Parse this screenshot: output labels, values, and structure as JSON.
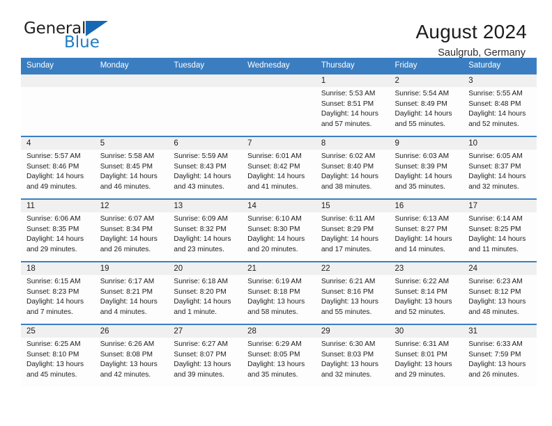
{
  "logo": {
    "word1": "General",
    "word2": "Blue",
    "triangle_color": "#1668b3",
    "blue_text_color": "#1f7cc4"
  },
  "header": {
    "title": "August 2024",
    "subtitle": "Saulgrub, Germany"
  },
  "theme": {
    "header_blue": "#3a7ec1",
    "daynum_band": "#f0f0f0",
    "cell_bg": "#fdfdfd",
    "text": "#1c1c1c"
  },
  "weekdays": [
    "Sunday",
    "Monday",
    "Tuesday",
    "Wednesday",
    "Thursday",
    "Friday",
    "Saturday"
  ],
  "labels": {
    "sunrise_prefix": "Sunrise:",
    "sunset_prefix": "Sunset:",
    "daylight_prefix": "Daylight:"
  },
  "weeks": [
    [
      {
        "day": "",
        "empty": true
      },
      {
        "day": "",
        "empty": true
      },
      {
        "day": "",
        "empty": true
      },
      {
        "day": "",
        "empty": true
      },
      {
        "day": "1",
        "sunrise": "Sunrise: 5:53 AM",
        "sunset": "Sunset: 8:51 PM",
        "daylight": "Daylight: 14 hours and 57 minutes."
      },
      {
        "day": "2",
        "sunrise": "Sunrise: 5:54 AM",
        "sunset": "Sunset: 8:49 PM",
        "daylight": "Daylight: 14 hours and 55 minutes."
      },
      {
        "day": "3",
        "sunrise": "Sunrise: 5:55 AM",
        "sunset": "Sunset: 8:48 PM",
        "daylight": "Daylight: 14 hours and 52 minutes."
      }
    ],
    [
      {
        "day": "4",
        "sunrise": "Sunrise: 5:57 AM",
        "sunset": "Sunset: 8:46 PM",
        "daylight": "Daylight: 14 hours and 49 minutes."
      },
      {
        "day": "5",
        "sunrise": "Sunrise: 5:58 AM",
        "sunset": "Sunset: 8:45 PM",
        "daylight": "Daylight: 14 hours and 46 minutes."
      },
      {
        "day": "6",
        "sunrise": "Sunrise: 5:59 AM",
        "sunset": "Sunset: 8:43 PM",
        "daylight": "Daylight: 14 hours and 43 minutes."
      },
      {
        "day": "7",
        "sunrise": "Sunrise: 6:01 AM",
        "sunset": "Sunset: 8:42 PM",
        "daylight": "Daylight: 14 hours and 41 minutes."
      },
      {
        "day": "8",
        "sunrise": "Sunrise: 6:02 AM",
        "sunset": "Sunset: 8:40 PM",
        "daylight": "Daylight: 14 hours and 38 minutes."
      },
      {
        "day": "9",
        "sunrise": "Sunrise: 6:03 AM",
        "sunset": "Sunset: 8:39 PM",
        "daylight": "Daylight: 14 hours and 35 minutes."
      },
      {
        "day": "10",
        "sunrise": "Sunrise: 6:05 AM",
        "sunset": "Sunset: 8:37 PM",
        "daylight": "Daylight: 14 hours and 32 minutes."
      }
    ],
    [
      {
        "day": "11",
        "sunrise": "Sunrise: 6:06 AM",
        "sunset": "Sunset: 8:35 PM",
        "daylight": "Daylight: 14 hours and 29 minutes."
      },
      {
        "day": "12",
        "sunrise": "Sunrise: 6:07 AM",
        "sunset": "Sunset: 8:34 PM",
        "daylight": "Daylight: 14 hours and 26 minutes."
      },
      {
        "day": "13",
        "sunrise": "Sunrise: 6:09 AM",
        "sunset": "Sunset: 8:32 PM",
        "daylight": "Daylight: 14 hours and 23 minutes."
      },
      {
        "day": "14",
        "sunrise": "Sunrise: 6:10 AM",
        "sunset": "Sunset: 8:30 PM",
        "daylight": "Daylight: 14 hours and 20 minutes."
      },
      {
        "day": "15",
        "sunrise": "Sunrise: 6:11 AM",
        "sunset": "Sunset: 8:29 PM",
        "daylight": "Daylight: 14 hours and 17 minutes."
      },
      {
        "day": "16",
        "sunrise": "Sunrise: 6:13 AM",
        "sunset": "Sunset: 8:27 PM",
        "daylight": "Daylight: 14 hours and 14 minutes."
      },
      {
        "day": "17",
        "sunrise": "Sunrise: 6:14 AM",
        "sunset": "Sunset: 8:25 PM",
        "daylight": "Daylight: 14 hours and 11 minutes."
      }
    ],
    [
      {
        "day": "18",
        "sunrise": "Sunrise: 6:15 AM",
        "sunset": "Sunset: 8:23 PM",
        "daylight": "Daylight: 14 hours and 7 minutes."
      },
      {
        "day": "19",
        "sunrise": "Sunrise: 6:17 AM",
        "sunset": "Sunset: 8:21 PM",
        "daylight": "Daylight: 14 hours and 4 minutes."
      },
      {
        "day": "20",
        "sunrise": "Sunrise: 6:18 AM",
        "sunset": "Sunset: 8:20 PM",
        "daylight": "Daylight: 14 hours and 1 minute."
      },
      {
        "day": "21",
        "sunrise": "Sunrise: 6:19 AM",
        "sunset": "Sunset: 8:18 PM",
        "daylight": "Daylight: 13 hours and 58 minutes."
      },
      {
        "day": "22",
        "sunrise": "Sunrise: 6:21 AM",
        "sunset": "Sunset: 8:16 PM",
        "daylight": "Daylight: 13 hours and 55 minutes."
      },
      {
        "day": "23",
        "sunrise": "Sunrise: 6:22 AM",
        "sunset": "Sunset: 8:14 PM",
        "daylight": "Daylight: 13 hours and 52 minutes."
      },
      {
        "day": "24",
        "sunrise": "Sunrise: 6:23 AM",
        "sunset": "Sunset: 8:12 PM",
        "daylight": "Daylight: 13 hours and 48 minutes."
      }
    ],
    [
      {
        "day": "25",
        "sunrise": "Sunrise: 6:25 AM",
        "sunset": "Sunset: 8:10 PM",
        "daylight": "Daylight: 13 hours and 45 minutes."
      },
      {
        "day": "26",
        "sunrise": "Sunrise: 6:26 AM",
        "sunset": "Sunset: 8:08 PM",
        "daylight": "Daylight: 13 hours and 42 minutes."
      },
      {
        "day": "27",
        "sunrise": "Sunrise: 6:27 AM",
        "sunset": "Sunset: 8:07 PM",
        "daylight": "Daylight: 13 hours and 39 minutes."
      },
      {
        "day": "28",
        "sunrise": "Sunrise: 6:29 AM",
        "sunset": "Sunset: 8:05 PM",
        "daylight": "Daylight: 13 hours and 35 minutes."
      },
      {
        "day": "29",
        "sunrise": "Sunrise: 6:30 AM",
        "sunset": "Sunset: 8:03 PM",
        "daylight": "Daylight: 13 hours and 32 minutes."
      },
      {
        "day": "30",
        "sunrise": "Sunrise: 6:31 AM",
        "sunset": "Sunset: 8:01 PM",
        "daylight": "Daylight: 13 hours and 29 minutes."
      },
      {
        "day": "31",
        "sunrise": "Sunrise: 6:33 AM",
        "sunset": "Sunset: 7:59 PM",
        "daylight": "Daylight: 13 hours and 26 minutes."
      }
    ]
  ]
}
